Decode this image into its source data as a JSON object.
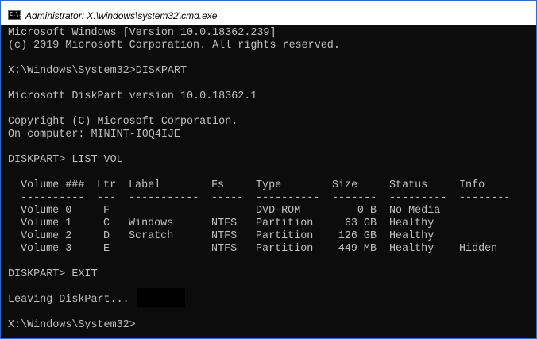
{
  "window": {
    "title": "Administrator: X:\\windows\\system32\\cmd.exe",
    "icon": "cmd-icon",
    "icon_text": "C:\\."
  },
  "console": {
    "lines": [
      "Microsoft Windows [Version 10.0.18362.239]",
      "(c) 2019 Microsoft Corporation. All rights reserved.",
      "X:\\Windows\\System32>DISKPART",
      "Microsoft DiskPart version 10.0.18362.1",
      "Copyright (C) Microsoft Corporation.",
      "On computer: MININT-I0Q4IJE",
      "DISKPART> LIST VOL",
      "DISKPART> EXIT",
      "Leaving DiskPart...",
      "X:\\Windows\\System32>"
    ],
    "table": {
      "headers": [
        "Volume ###",
        "Ltr",
        "Label",
        "Fs",
        "Type",
        "Size",
        "Status",
        "Info"
      ],
      "separators": [
        "----------",
        "---",
        "-----------",
        "-----",
        "----------",
        "-------",
        "---------",
        "--------"
      ],
      "rows": [
        [
          "Volume 0",
          "F",
          "",
          "",
          "DVD-ROM",
          "0 B",
          "No Media",
          ""
        ],
        [
          "Volume 1",
          "C",
          "Windows",
          "NTFS",
          "Partition",
          "63 GB",
          "Healthy",
          ""
        ],
        [
          "Volume 2",
          "D",
          "Scratch",
          "NTFS",
          "Partition",
          "126 GB",
          "Healthy",
          ""
        ],
        [
          "Volume 3",
          "E",
          "",
          "NTFS",
          "Partition",
          "449 MB",
          "Healthy",
          "Hidden"
        ]
      ]
    }
  },
  "colors": {
    "console_bg": "#0c0c0c",
    "console_fg": "#c0c0c0",
    "border": "#2b6cc9"
  }
}
